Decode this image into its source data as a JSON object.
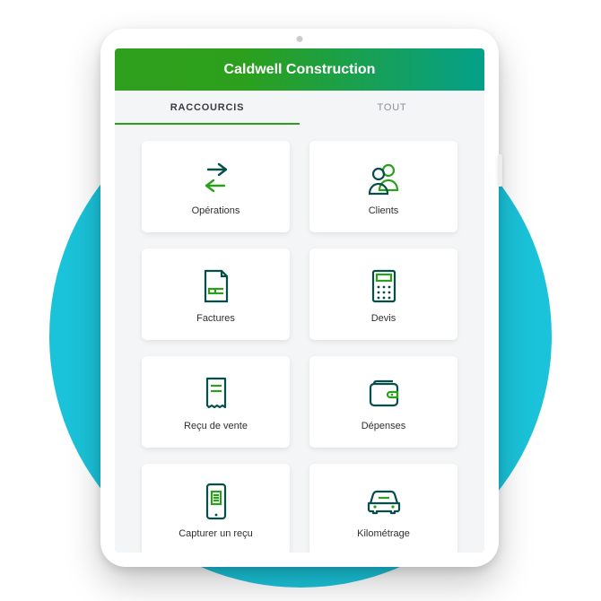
{
  "header": {
    "title": "Caldwell Construction"
  },
  "tabs": {
    "shortcuts": "RACCOURCIS",
    "all": "TOUT",
    "active": "shortcuts"
  },
  "shortcuts": [
    {
      "key": "operations",
      "label": "Opérations",
      "icon": "arrows-exchange-icon"
    },
    {
      "key": "clients",
      "label": "Clients",
      "icon": "people-icon"
    },
    {
      "key": "invoices",
      "label": "Factures",
      "icon": "invoice-doc-icon"
    },
    {
      "key": "quotes",
      "label": "Devis",
      "icon": "calculator-icon"
    },
    {
      "key": "sales-rcpt",
      "label": "Reçu de vente",
      "icon": "receipt-icon"
    },
    {
      "key": "expenses",
      "label": "Dépenses",
      "icon": "wallet-icon"
    },
    {
      "key": "capture",
      "label": "Capturer un reçu",
      "icon": "phone-receipt-icon"
    },
    {
      "key": "mileage",
      "label": "Kilométrage",
      "icon": "car-icon"
    }
  ],
  "colors": {
    "green": "#2ca01c",
    "teal": "#04a089",
    "dark": "#054e4a"
  }
}
